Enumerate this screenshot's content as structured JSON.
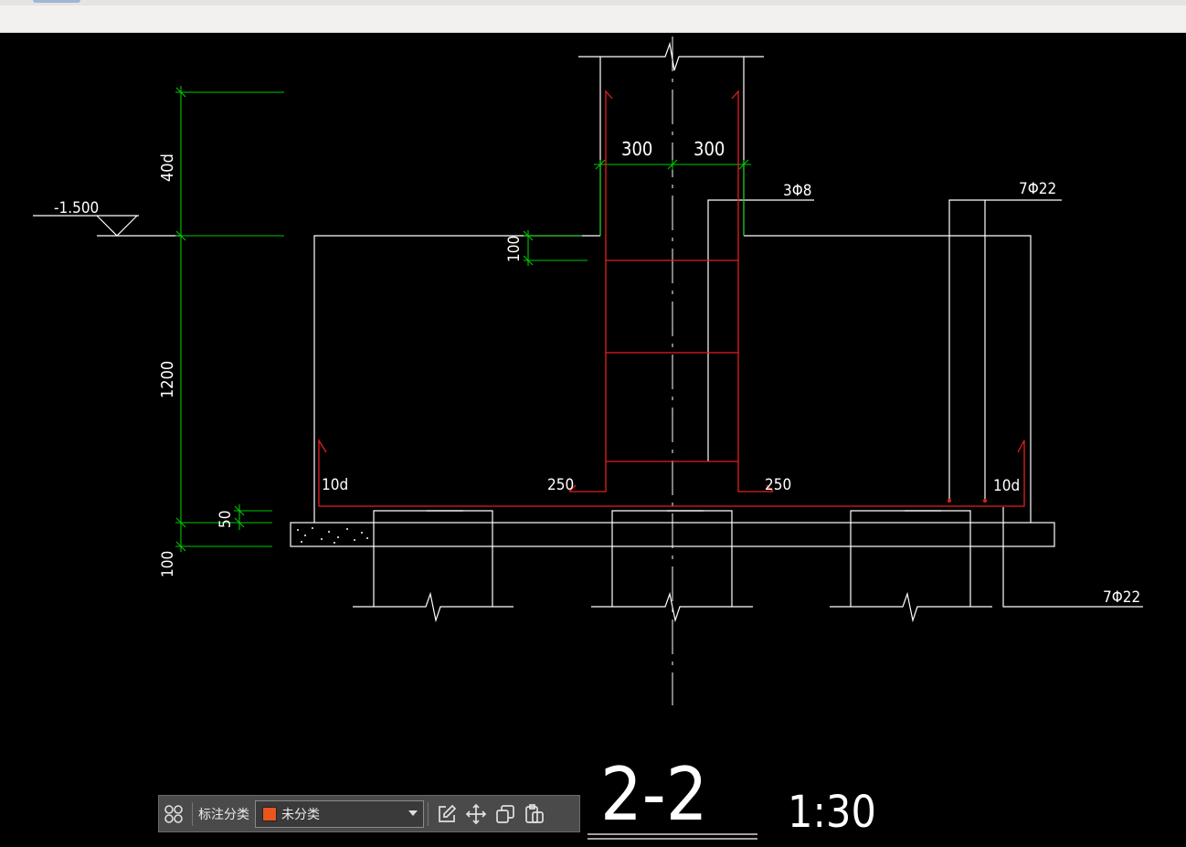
{
  "drawing": {
    "section_title": "2-2",
    "scale": "1:30",
    "elevation_mark": "-1.500",
    "dimensions": {
      "anchor_top": "40d",
      "height_main": "1200",
      "cushion": "50",
      "bottom": "100",
      "step": "100",
      "half_left": "300",
      "half_right": "300",
      "hook_left": "10d",
      "hook_right": "10d",
      "bend_left": "250",
      "bend_right": "250"
    },
    "rebar_labels": {
      "stirrups": "3Φ8",
      "top_bars": "7Φ22",
      "bottom_bars": "7Φ22"
    },
    "colors": {
      "background": "#000000",
      "outline": "#ffffff",
      "dimension": "#00c800",
      "rebar": "#e0201c"
    }
  },
  "toolbar": {
    "grid_icon": "grid-icon",
    "category_label": "标注分类",
    "category_value": "未分类",
    "category_color": "#e8561e",
    "icons": [
      "edit-icon",
      "move-icon",
      "copy-icon",
      "paste-icon"
    ]
  }
}
